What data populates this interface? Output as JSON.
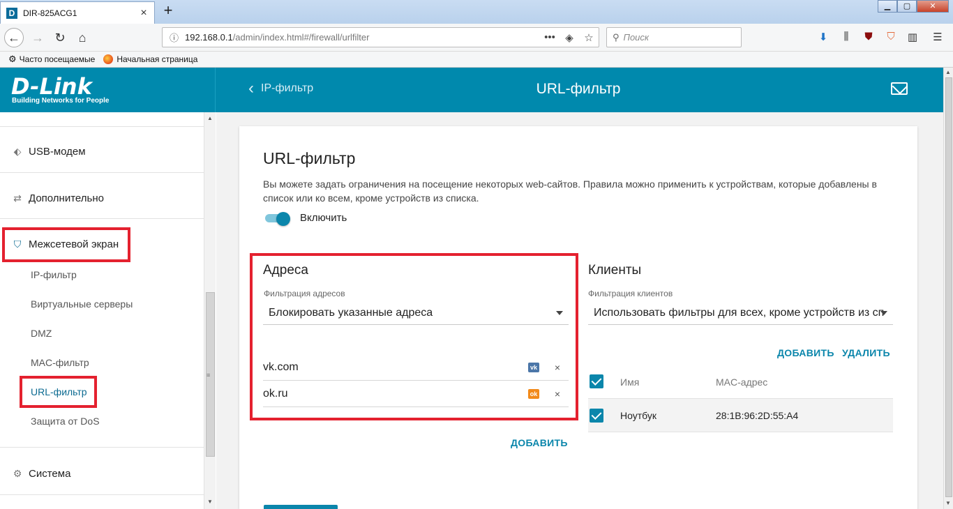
{
  "browser": {
    "tab_favicon": "D",
    "tab_title": "DIR-825ACG1",
    "tab_close": "×",
    "new_tab": "+",
    "url_host": "192.168.0.1",
    "url_path": "/admin/index.html#/firewall/urlfilter",
    "search_placeholder": "Поиск",
    "bookmarks": [
      "Часто посещаемые",
      "Начальная страница"
    ]
  },
  "header": {
    "logo": "D-Link",
    "slogan": "Building Networks for People",
    "back_label": "IP-фильтр",
    "page_title": "URL-фильтр"
  },
  "sidebar": {
    "sections": {
      "usb": "USB-модем",
      "advanced": "Дополнительно",
      "firewall": "Межсетевой экран",
      "system": "Система"
    },
    "firewall_items": [
      "IP-фильтр",
      "Виртуальные серверы",
      "DMZ",
      "MAC-фильтр",
      "URL-фильтр",
      "Защита от DoS"
    ],
    "active_item": "URL-фильтр"
  },
  "main": {
    "title": "URL-фильтр",
    "description": "Вы можете задать ограничения на посещение некоторых web-сайтов. Правила можно применить к устройствам, которые добавлены в список или ко всем, кроме устройств из списка.",
    "enable_label": "Включить",
    "enabled": true,
    "addresses": {
      "title": "Адреса",
      "filter_label": "Фильтрация адресов",
      "filter_value": "Блокировать указанные адреса",
      "items": [
        {
          "url": "vk.com",
          "icon": "vk-icon",
          "icon_text": "vk"
        },
        {
          "url": "ok.ru",
          "icon": "ok-icon",
          "icon_text": "ok"
        }
      ],
      "remove_symbol": "×",
      "add_label": "ДОБАВИТЬ"
    },
    "clients": {
      "title": "Клиенты",
      "filter_label": "Фильтрация клиентов",
      "filter_value": "Использовать фильтры для всех, кроме устройств из сп",
      "add_label": "ДОБАВИТЬ",
      "delete_label": "УДАЛИТЬ",
      "columns": [
        "Имя",
        "MAC-адрес"
      ],
      "rows": [
        {
          "name": "Ноутбук",
          "mac": "28:1B:96:2D:55:A4",
          "checked": true
        }
      ]
    }
  },
  "colors": {
    "brand": "#0089ad",
    "accent": "#0b86ab",
    "highlight": "#e4212f"
  }
}
